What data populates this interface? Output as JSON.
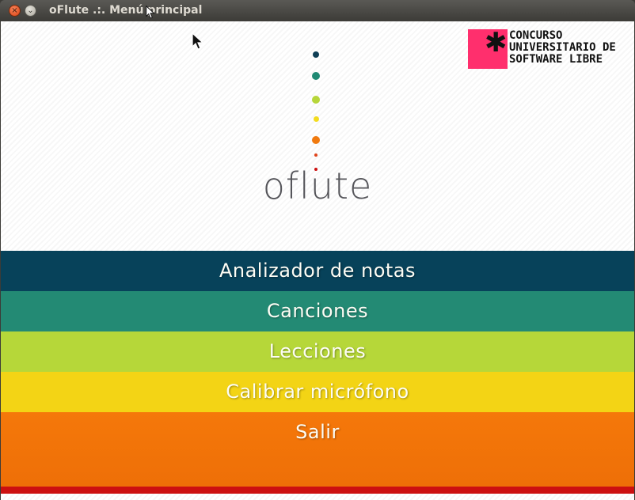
{
  "window": {
    "title": "oFlute .:. Menú principal",
    "close_glyph": "×",
    "minimize_glyph": "⌄"
  },
  "logo": {
    "text": "oflute",
    "dot_colors": [
      "#0f3f56",
      "#1f8a74",
      "#b7d63a",
      "#f3dc1f",
      "#f07a0f",
      "#e0431a",
      "#cc1010"
    ]
  },
  "badge": {
    "lines": [
      "CONCURSO",
      "UNIVERSITARIO DE",
      "SOFTWARE LIBRE"
    ],
    "asterisk": "✱",
    "accent_color": "#ff2f6d"
  },
  "menu": {
    "items": [
      {
        "label": "Analizador de notas",
        "color": "#07425a"
      },
      {
        "label": "Canciones",
        "color": "#238a74"
      },
      {
        "label": "Lecciones",
        "color": "#b6d739"
      },
      {
        "label": "Calibrar micrófono",
        "color": "#f3d415"
      },
      {
        "label": "Salir",
        "color": "#f5780a"
      }
    ],
    "bottom_bar_color": "#cc1010"
  }
}
